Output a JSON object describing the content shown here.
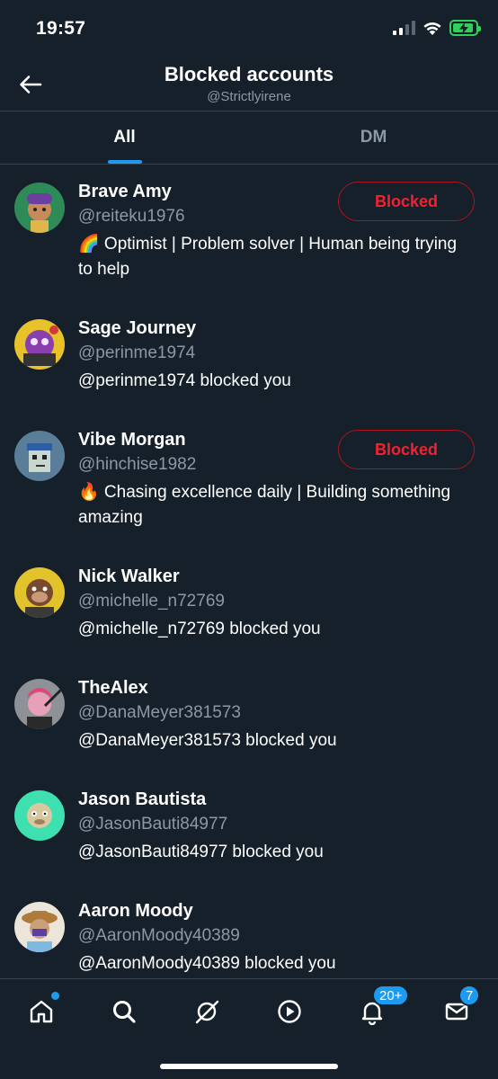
{
  "status_bar": {
    "time": "19:57"
  },
  "header": {
    "title": "Blocked accounts",
    "subtitle": "@Strictlyirene"
  },
  "tabs": [
    {
      "label": "All",
      "active": true
    },
    {
      "label": "DM",
      "active": false
    }
  ],
  "accounts": [
    {
      "name": "Brave Amy",
      "handle": "@reiteku1976",
      "bio": "🌈 Optimist | Problem solver | Human being trying to help",
      "button": "Blocked"
    },
    {
      "name": "Sage Journey",
      "handle": "@perinme1974",
      "bio": "@perinme1974 blocked you"
    },
    {
      "name": "Vibe Morgan",
      "handle": "@hinchise1982",
      "bio": "🔥 Chasing excellence daily | Building something amazing",
      "button": "Blocked"
    },
    {
      "name": "Nick Walker",
      "handle": "@michelle_n72769",
      "bio": "@michelle_n72769 blocked you"
    },
    {
      "name": "TheAlex",
      "handle": "@DanaMeyer381573",
      "bio": "@DanaMeyer381573 blocked you"
    },
    {
      "name": "Jason Bautista",
      "handle": "@JasonBauti84977",
      "bio": "@JasonBauti84977 blocked you"
    },
    {
      "name": "Aaron Moody",
      "handle": "@AaronMoody40389",
      "bio": "@AaronMoody40389 blocked you"
    }
  ],
  "nav": {
    "items": [
      "home-icon",
      "search-icon",
      "grok-icon",
      "video-icon",
      "notifications-icon",
      "messages-icon"
    ],
    "notifications_badge": "20+",
    "messages_badge": "7"
  },
  "colors": {
    "background": "#15202b",
    "accent": "#1d9bf0",
    "blocked_red": "#f4212e",
    "secondary_text": "#8b98a5"
  }
}
